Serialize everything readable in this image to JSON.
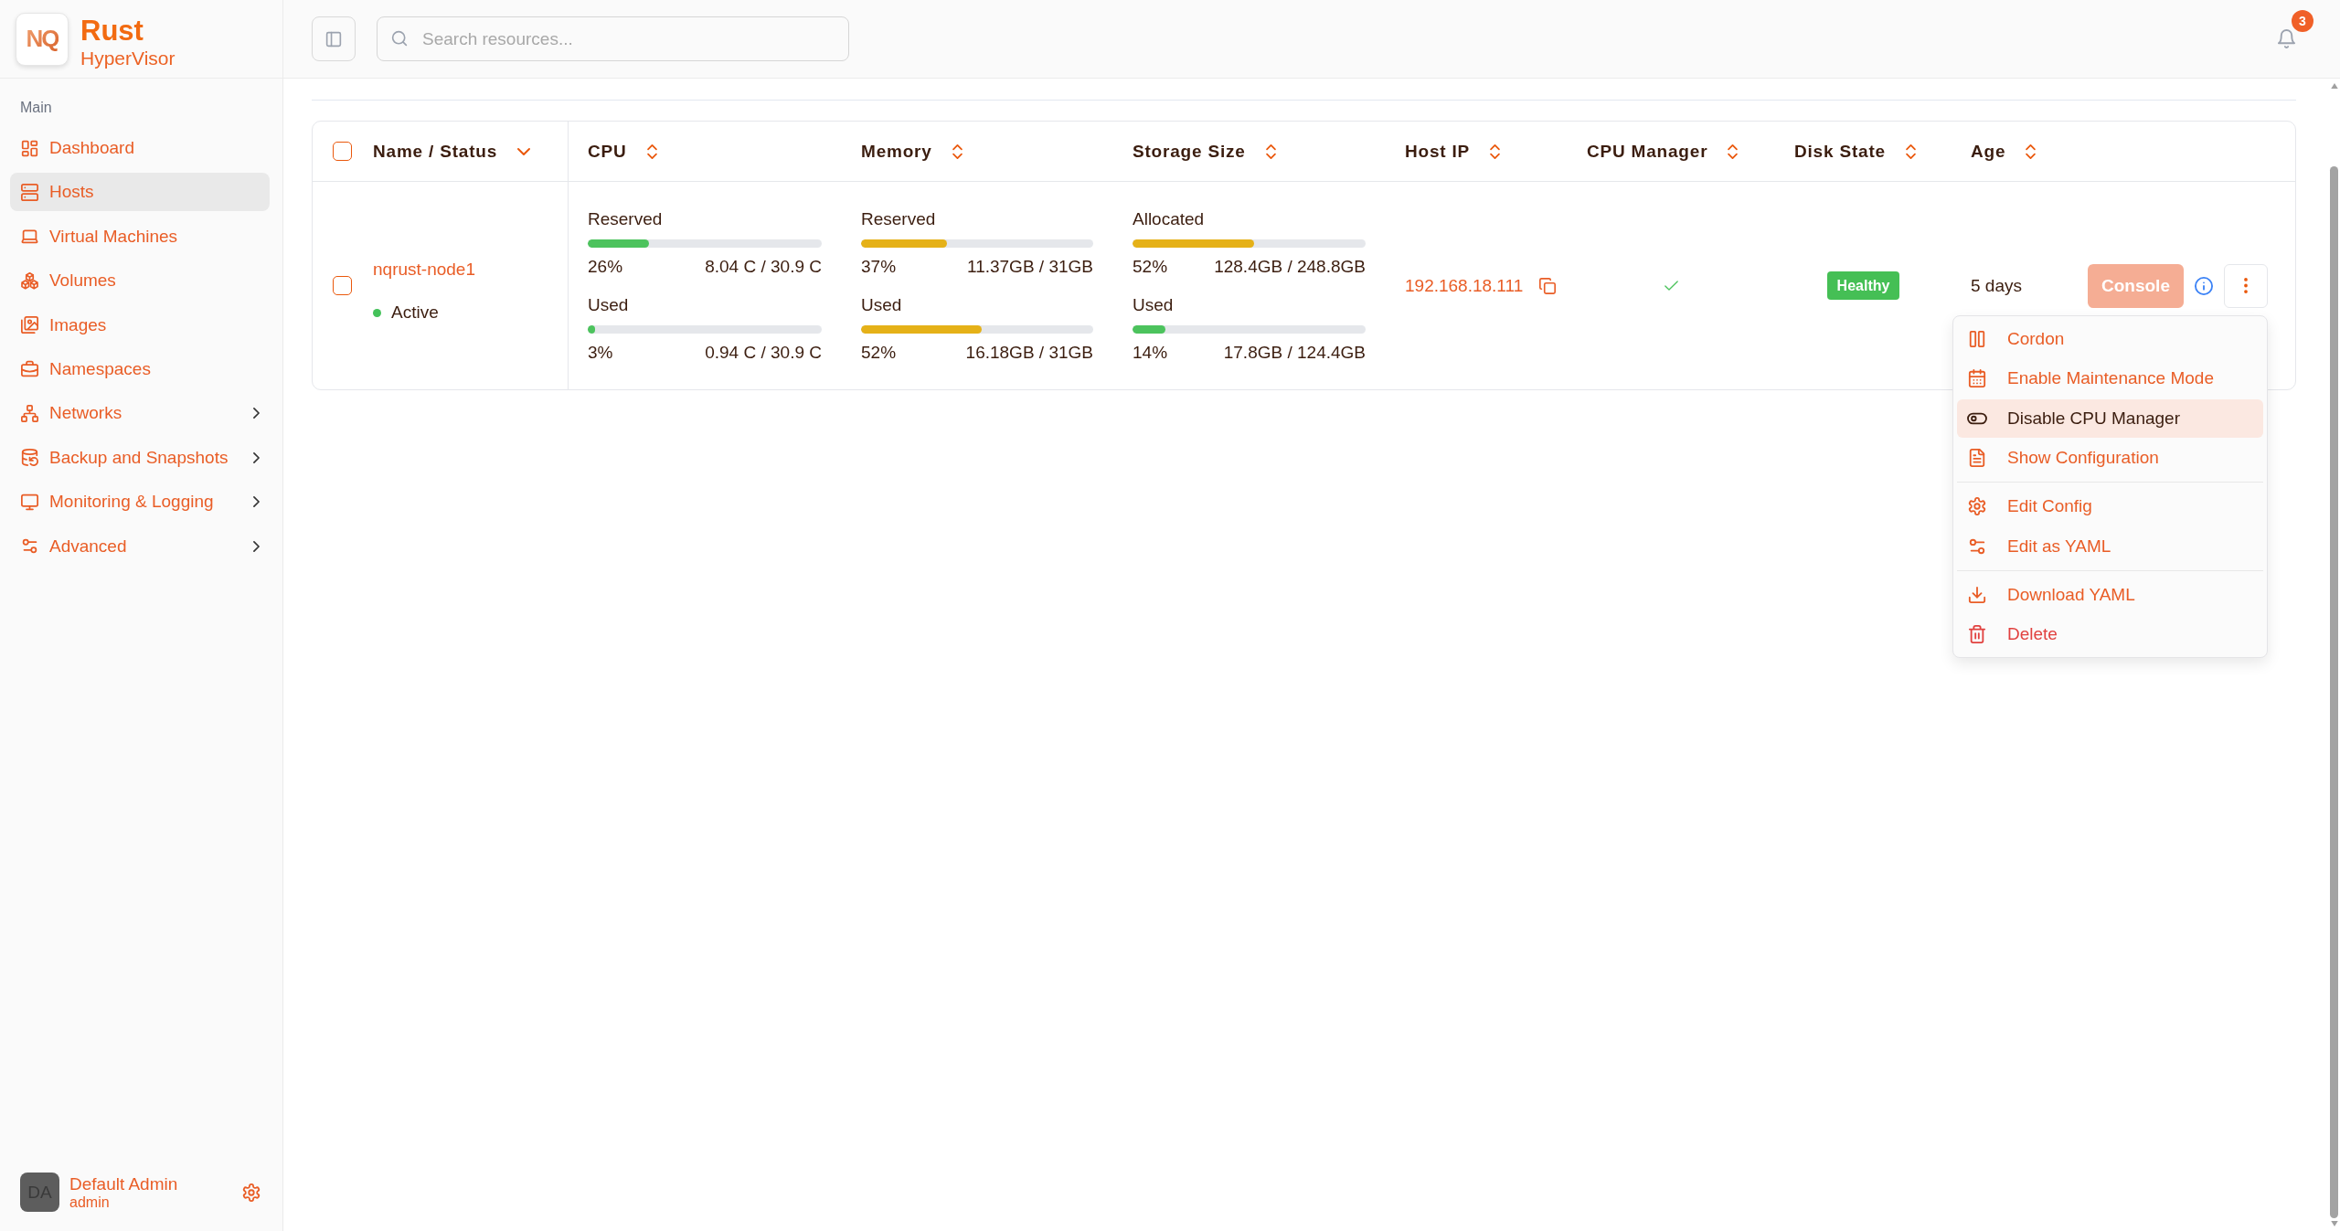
{
  "sidebar": {
    "brand": {
      "logo": "NQ",
      "name": "Rust",
      "subtitle": "HyperVisor"
    },
    "section_label": "Main",
    "items": [
      {
        "label": "Dashboard",
        "selected": false,
        "expandable": false
      },
      {
        "label": "Hosts",
        "selected": true,
        "expandable": false
      },
      {
        "label": "Virtual Machines",
        "selected": false,
        "expandable": false
      },
      {
        "label": "Volumes",
        "selected": false,
        "expandable": false
      },
      {
        "label": "Images",
        "selected": false,
        "expandable": false
      },
      {
        "label": "Namespaces",
        "selected": false,
        "expandable": false
      },
      {
        "label": "Networks",
        "selected": false,
        "expandable": true
      },
      {
        "label": "Backup and Snapshots",
        "selected": false,
        "expandable": true
      },
      {
        "label": "Monitoring & Logging",
        "selected": false,
        "expandable": true
      },
      {
        "label": "Advanced",
        "selected": false,
        "expandable": true
      }
    ],
    "user": {
      "initials": "DA",
      "name": "Default Admin",
      "role": "admin"
    }
  },
  "topbar": {
    "search": {
      "placeholder": "Search resources..."
    },
    "notifications": {
      "count": "3"
    }
  },
  "table": {
    "select_all": {
      "checked": false
    },
    "columns": [
      {
        "label": "Name / Status",
        "sorted": true
      },
      {
        "label": "CPU",
        "sorted": false
      },
      {
        "label": "Memory",
        "sorted": false
      },
      {
        "label": "Storage Size",
        "sorted": false
      },
      {
        "label": "Host IP",
        "sorted": false
      },
      {
        "label": "CPU Manager",
        "sorted": false
      },
      {
        "label": "Disk State",
        "sorted": false
      },
      {
        "label": "Age",
        "sorted": false
      }
    ],
    "rows": [
      {
        "checked": false,
        "name": "nqrust-node1",
        "status": {
          "label": "Active",
          "color": "#44c25a"
        },
        "cpu": [
          {
            "label": "Reserved",
            "level": 0.26,
            "percent": "26%",
            "amount": "8.04 C / 30.9 C",
            "color": "#4cc35d"
          },
          {
            "label": "Used",
            "level": 0.03,
            "percent": "3%",
            "amount": "0.94 C / 30.9 C",
            "color": "#4cc35d"
          }
        ],
        "memory": [
          {
            "label": "Reserved",
            "level": 0.37,
            "percent": "37%",
            "amount": "11.37GB / 31GB",
            "color": "#e5b118"
          },
          {
            "label": "Used",
            "level": 0.52,
            "percent": "52%",
            "amount": "16.18GB / 31GB",
            "color": "#e5b118"
          }
        ],
        "storage": [
          {
            "label": "Allocated",
            "level": 0.52,
            "percent": "52%",
            "amount": "128.4GB / 248.8GB",
            "color": "#e5b118"
          },
          {
            "label": "Used",
            "level": 0.14,
            "percent": "14%",
            "amount": "17.8GB / 124.4GB",
            "color": "#4cc35d"
          }
        ],
        "host_ip": "192.168.18.111",
        "cpu_manager": true,
        "disk_state": {
          "label": "Healthy",
          "color": "#45bf55"
        },
        "age": "5 days",
        "console": {
          "label": "Console",
          "disabled": true
        },
        "actions_menu": {
          "open": true,
          "groups": [
            [
              {
                "label": "Cordon",
                "highlighted": false,
                "destructive": false
              },
              {
                "label": "Enable Maintenance Mode",
                "highlighted": false,
                "destructive": false
              },
              {
                "label": "Disable CPU Manager",
                "highlighted": true,
                "destructive": false
              },
              {
                "label": "Show Configuration",
                "highlighted": false,
                "destructive": false
              }
            ],
            [
              {
                "label": "Edit Config",
                "highlighted": false,
                "destructive": false
              },
              {
                "label": "Edit as YAML",
                "highlighted": false,
                "destructive": false
              }
            ],
            [
              {
                "label": "Download YAML",
                "highlighted": false,
                "destructive": false
              },
              {
                "label": "Delete",
                "highlighted": false,
                "destructive": true
              }
            ]
          ]
        }
      }
    ]
  }
}
